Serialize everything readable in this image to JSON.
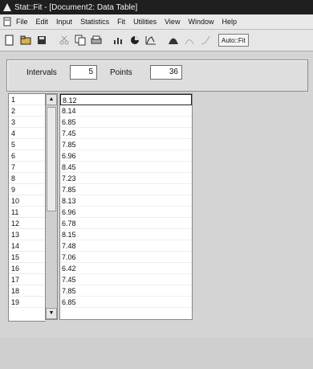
{
  "window": {
    "title": "Stat::Fit - [Document2: Data Table]"
  },
  "menu": {
    "items": [
      "File",
      "Edit",
      "Input",
      "Statistics",
      "Fit",
      "Utilities",
      "View",
      "Window",
      "Help"
    ]
  },
  "toolbar": {
    "icons": [
      "new-file-icon",
      "open-folder-icon",
      "save-icon",
      "cut-icon",
      "copy-icon",
      "print-icon",
      "chart-settings-icon",
      "pie-chart-icon",
      "histogram-icon",
      "fit-icon",
      "fit-pdf-icon",
      "fit-cdf-icon"
    ],
    "auto_label": "Auto::Fit"
  },
  "params": {
    "intervals_label": "Intervals",
    "intervals_value": "5",
    "points_label": "Points",
    "points_value": "36"
  },
  "table": {
    "rows": [
      {
        "n": "1",
        "v": "8.12"
      },
      {
        "n": "2",
        "v": "8.14"
      },
      {
        "n": "3",
        "v": "6.85"
      },
      {
        "n": "4",
        "v": "7.45"
      },
      {
        "n": "5",
        "v": "7.85"
      },
      {
        "n": "6",
        "v": "6.96"
      },
      {
        "n": "7",
        "v": "8.45"
      },
      {
        "n": "8",
        "v": "7.23"
      },
      {
        "n": "9",
        "v": "7.85"
      },
      {
        "n": "10",
        "v": "8.13"
      },
      {
        "n": "11",
        "v": "6.96"
      },
      {
        "n": "12",
        "v": "6.78"
      },
      {
        "n": "13",
        "v": "8.15"
      },
      {
        "n": "14",
        "v": "7.48"
      },
      {
        "n": "15",
        "v": "7.06"
      },
      {
        "n": "16",
        "v": "6.42"
      },
      {
        "n": "17",
        "v": "7.45"
      },
      {
        "n": "18",
        "v": "7.85"
      },
      {
        "n": "19",
        "v": "6.85"
      }
    ]
  }
}
